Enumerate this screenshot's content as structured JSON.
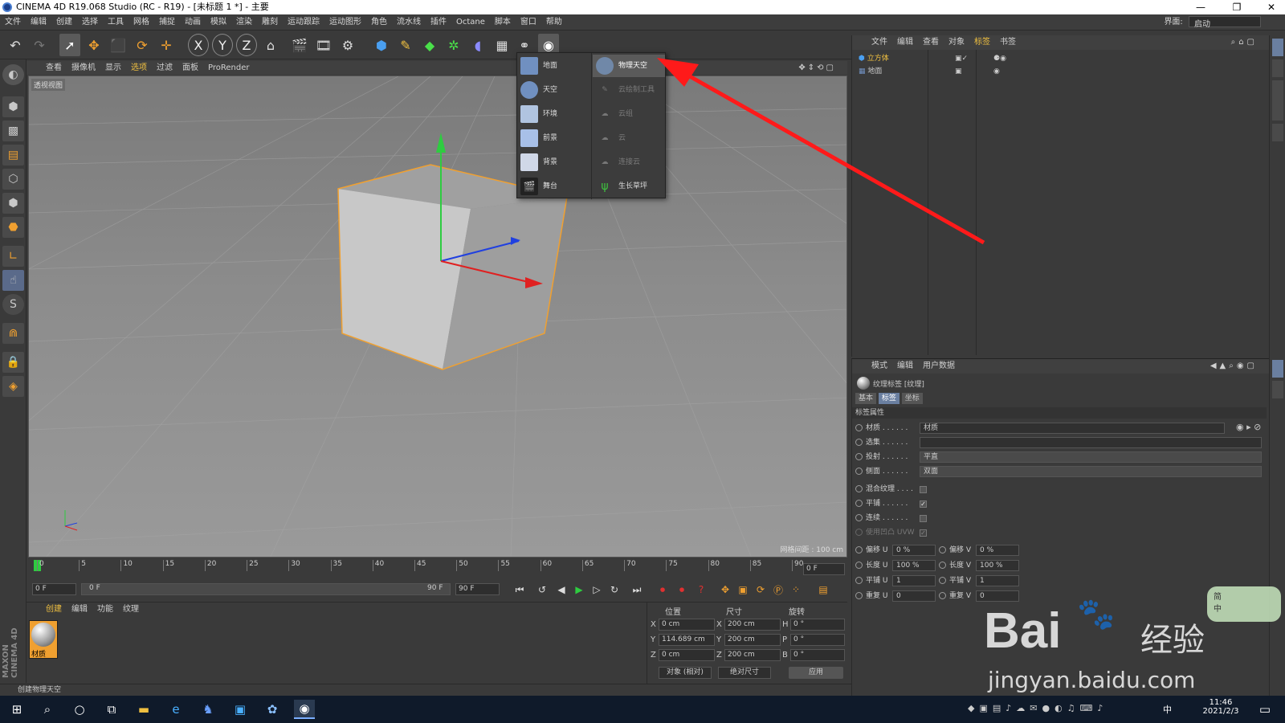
{
  "window": {
    "title": "CINEMA 4D R19.068 Studio (RC - R19) - [未标题 1 *] - 主要",
    "controls": [
      "—",
      "❐",
      "✕"
    ]
  },
  "menubar": {
    "items": [
      "文件",
      "编辑",
      "创建",
      "选择",
      "工具",
      "网格",
      "捕捉",
      "动画",
      "模拟",
      "渲染",
      "雕刻",
      "运动跟踪",
      "运动图形",
      "角色",
      "流水线",
      "插件",
      "Octane",
      "脚本",
      "窗口",
      "帮助"
    ],
    "layout_label": "界面:",
    "layout_value": "启动"
  },
  "viewport": {
    "menu": [
      "查看",
      "摄像机",
      "显示",
      "选项",
      "过滤",
      "面板",
      "ProRender"
    ],
    "label": "透视视图",
    "grid_info": "网格间距 : 100 cm"
  },
  "popup": {
    "left_items": [
      {
        "label": "地面",
        "icon": "floor-icon"
      },
      {
        "label": "天空",
        "icon": "sky-icon"
      },
      {
        "label": "环境",
        "icon": "environment-icon"
      },
      {
        "label": "前景",
        "icon": "foreground-icon"
      },
      {
        "label": "背景",
        "icon": "background-icon"
      },
      {
        "label": "舞台",
        "icon": "stage-icon"
      }
    ],
    "right_items": [
      {
        "label": "物理天空",
        "icon": "physical-sky-icon",
        "enabled": true
      },
      {
        "label": "云绘制工具",
        "icon": "cloud-paint-icon",
        "enabled": false
      },
      {
        "label": "云组",
        "icon": "cloud-group-icon",
        "enabled": false
      },
      {
        "label": "云",
        "icon": "cloud-icon",
        "enabled": false
      },
      {
        "label": "连接云",
        "icon": "connect-cloud-icon",
        "enabled": false
      },
      {
        "label": "生长草坪",
        "icon": "grass-icon",
        "enabled": true
      }
    ]
  },
  "timeline": {
    "ticks": [
      "0",
      "5",
      "10",
      "15",
      "20",
      "25",
      "30",
      "35",
      "40",
      "45",
      "50",
      "55",
      "60",
      "65",
      "70",
      "75",
      "80",
      "85",
      "90"
    ],
    "current_frame": "0 F",
    "start_field": "0 F",
    "range_start": "0 F",
    "range_end": "90 F",
    "end_field": "90 F"
  },
  "material_manager": {
    "menu": [
      "创建",
      "编辑",
      "功能",
      "纹理"
    ],
    "material_name": "材质"
  },
  "coordinates": {
    "headers": [
      "位置",
      "尺寸",
      "旋转"
    ],
    "rows": [
      {
        "axis": "X",
        "pos": "0 cm",
        "saxis": "X",
        "size": "200 cm",
        "raxis": "H",
        "rot": "0 °"
      },
      {
        "axis": "Y",
        "pos": "114.689 cm",
        "saxis": "Y",
        "size": "200 cm",
        "raxis": "P",
        "rot": "0 °"
      },
      {
        "axis": "Z",
        "pos": "0 cm",
        "saxis": "Z",
        "size": "200 cm",
        "raxis": "B",
        "rot": "0 °"
      }
    ],
    "mode1": "对象 (相对)",
    "mode2": "绝对尺寸",
    "apply": "应用"
  },
  "status": "创建物理天空",
  "object_manager": {
    "menu": [
      "文件",
      "编辑",
      "查看",
      "对象",
      "标签",
      "书签"
    ],
    "objects": [
      {
        "name": "立方体",
        "color": "#f0c040"
      },
      {
        "name": "地面",
        "color": "#d0d0d0"
      }
    ]
  },
  "attribute_manager": {
    "menu": [
      "模式",
      "编辑",
      "用户数据"
    ],
    "title": "纹理标签 [纹理]",
    "tabs": [
      "基本",
      "标签",
      "坐标"
    ],
    "section": "标签属性",
    "material_label": "材质 . . . . . .",
    "material_value": "材质",
    "selection_label": "选集 . . . . . .",
    "projection_label": "投射 . . . . . .",
    "projection_value": "平直",
    "side_label": "侧面 . . . . . .",
    "side_value": "双面",
    "mix_label": "混合纹理 . . . .",
    "tile_label": "平铺 . . . . . .",
    "seamless_label": "连续 . . . . . .",
    "uvw_label": "使用凹凸 UVW",
    "check_mark": "✓",
    "offset_u": "偏移 U",
    "offset_u_val": "0 %",
    "offset_v": "偏移 V",
    "offset_v_val": "0 %",
    "length_u": "长度 U",
    "length_u_val": "100 %",
    "length_v": "长度 V",
    "length_v_val": "100 %",
    "tiles_u": "平铺 U",
    "tiles_u_val": "1",
    "tiles_v": "平铺 V",
    "tiles_v_val": "1",
    "repeat_u": "重复 U",
    "repeat_u_val": "0",
    "repeat_v": "重复 V",
    "repeat_v_val": "0"
  },
  "taskbar": {
    "time": "11:46",
    "date": "2021/2/3",
    "ime": "中"
  },
  "watermark": {
    "brand": "Bai",
    "brand2": "经验",
    "url": "jingyan.baidu.com",
    "badge1": "简",
    "badge2": "中"
  },
  "colors": {
    "accent_orange": "#f0a030",
    "arrow_red": "#ff1a1a",
    "axis_green": "#2ecc40",
    "axis_red": "#e02020",
    "axis_blue": "#2040e0"
  },
  "brand_vertical": "MAXON CINEMA 4D"
}
